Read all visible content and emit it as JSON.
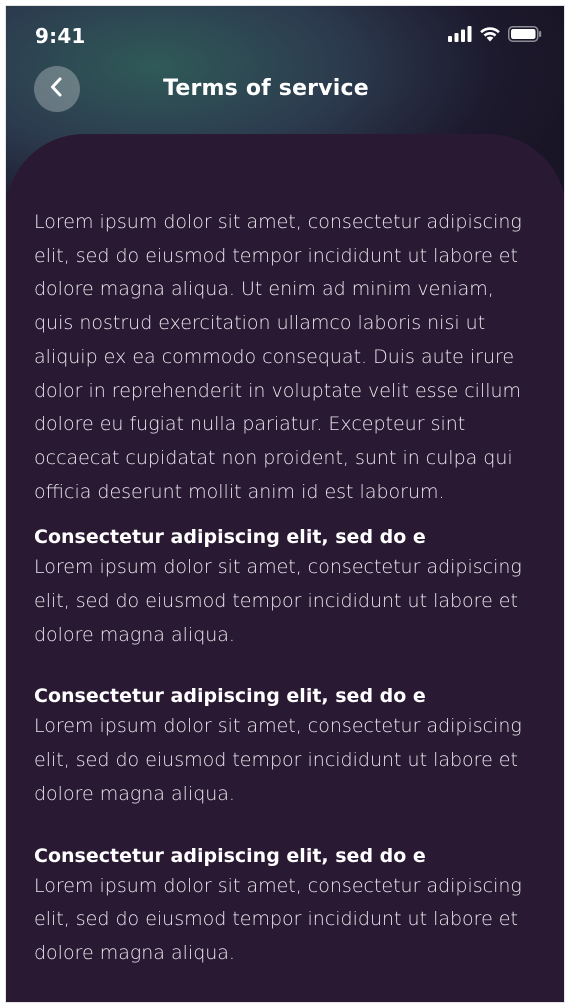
{
  "status_bar": {
    "time": "9:41",
    "icons": [
      "cellular-signal-icon",
      "wifi-icon",
      "battery-icon"
    ]
  },
  "header": {
    "title": "Terms of service",
    "back_icon": "chevron-left-icon"
  },
  "content": {
    "intro": "Lorem ipsum dolor sit amet, consectetur adipiscing elit, sed do eiusmod tempor incididunt ut labore et dolore magna aliqua. Ut enim ad minim veniam, quis nostrud exercitation ullamco laboris nisi ut aliquip ex ea commodo consequat. Duis aute irure dolor in reprehenderit in voluptate velit esse cillum dolore eu fugiat nulla pariatur. Excepteur sint occaecat cupidatat non proident, sunt in culpa qui officia deserunt mollit anim id est laborum.",
    "sections": [
      {
        "heading": "Consectetur adipiscing elit, sed do e",
        "body": "Lorem ipsum dolor sit amet, consectetur adipiscing elit, sed do eiusmod tempor incididunt ut labore et dolore magna aliqua."
      },
      {
        "heading": "Consectetur adipiscing elit, sed do e",
        "body": "Lorem ipsum dolor sit amet, consectetur adipiscing elit, sed do eiusmod tempor incididunt ut labore et dolore magna aliqua."
      },
      {
        "heading": "Consectetur adipiscing elit, sed do e",
        "body": "Lorem ipsum dolor sit amet, consectetur adipiscing elit, sed do eiusmod tempor incididunt ut labore et dolore magna aliqua."
      }
    ]
  },
  "colors": {
    "card_background": "#291932",
    "header_gradient_accent": "#2f5a58",
    "text_primary": "#ffffff",
    "text_body": "#ece8ef"
  }
}
